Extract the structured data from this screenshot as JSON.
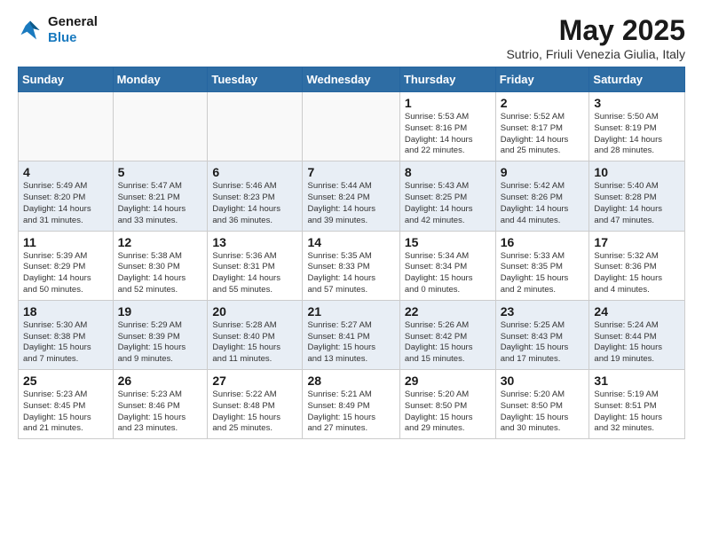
{
  "header": {
    "logo_general": "General",
    "logo_blue": "Blue",
    "month_year": "May 2025",
    "subtitle": "Sutrio, Friuli Venezia Giulia, Italy"
  },
  "days_of_week": [
    "Sunday",
    "Monday",
    "Tuesday",
    "Wednesday",
    "Thursday",
    "Friday",
    "Saturday"
  ],
  "weeks": [
    [
      {
        "day": "",
        "info": ""
      },
      {
        "day": "",
        "info": ""
      },
      {
        "day": "",
        "info": ""
      },
      {
        "day": "",
        "info": ""
      },
      {
        "day": "1",
        "info": "Sunrise: 5:53 AM\nSunset: 8:16 PM\nDaylight: 14 hours\nand 22 minutes."
      },
      {
        "day": "2",
        "info": "Sunrise: 5:52 AM\nSunset: 8:17 PM\nDaylight: 14 hours\nand 25 minutes."
      },
      {
        "day": "3",
        "info": "Sunrise: 5:50 AM\nSunset: 8:19 PM\nDaylight: 14 hours\nand 28 minutes."
      }
    ],
    [
      {
        "day": "4",
        "info": "Sunrise: 5:49 AM\nSunset: 8:20 PM\nDaylight: 14 hours\nand 31 minutes."
      },
      {
        "day": "5",
        "info": "Sunrise: 5:47 AM\nSunset: 8:21 PM\nDaylight: 14 hours\nand 33 minutes."
      },
      {
        "day": "6",
        "info": "Sunrise: 5:46 AM\nSunset: 8:23 PM\nDaylight: 14 hours\nand 36 minutes."
      },
      {
        "day": "7",
        "info": "Sunrise: 5:44 AM\nSunset: 8:24 PM\nDaylight: 14 hours\nand 39 minutes."
      },
      {
        "day": "8",
        "info": "Sunrise: 5:43 AM\nSunset: 8:25 PM\nDaylight: 14 hours\nand 42 minutes."
      },
      {
        "day": "9",
        "info": "Sunrise: 5:42 AM\nSunset: 8:26 PM\nDaylight: 14 hours\nand 44 minutes."
      },
      {
        "day": "10",
        "info": "Sunrise: 5:40 AM\nSunset: 8:28 PM\nDaylight: 14 hours\nand 47 minutes."
      }
    ],
    [
      {
        "day": "11",
        "info": "Sunrise: 5:39 AM\nSunset: 8:29 PM\nDaylight: 14 hours\nand 50 minutes."
      },
      {
        "day": "12",
        "info": "Sunrise: 5:38 AM\nSunset: 8:30 PM\nDaylight: 14 hours\nand 52 minutes."
      },
      {
        "day": "13",
        "info": "Sunrise: 5:36 AM\nSunset: 8:31 PM\nDaylight: 14 hours\nand 55 minutes."
      },
      {
        "day": "14",
        "info": "Sunrise: 5:35 AM\nSunset: 8:33 PM\nDaylight: 14 hours\nand 57 minutes."
      },
      {
        "day": "15",
        "info": "Sunrise: 5:34 AM\nSunset: 8:34 PM\nDaylight: 15 hours\nand 0 minutes."
      },
      {
        "day": "16",
        "info": "Sunrise: 5:33 AM\nSunset: 8:35 PM\nDaylight: 15 hours\nand 2 minutes."
      },
      {
        "day": "17",
        "info": "Sunrise: 5:32 AM\nSunset: 8:36 PM\nDaylight: 15 hours\nand 4 minutes."
      }
    ],
    [
      {
        "day": "18",
        "info": "Sunrise: 5:30 AM\nSunset: 8:38 PM\nDaylight: 15 hours\nand 7 minutes."
      },
      {
        "day": "19",
        "info": "Sunrise: 5:29 AM\nSunset: 8:39 PM\nDaylight: 15 hours\nand 9 minutes."
      },
      {
        "day": "20",
        "info": "Sunrise: 5:28 AM\nSunset: 8:40 PM\nDaylight: 15 hours\nand 11 minutes."
      },
      {
        "day": "21",
        "info": "Sunrise: 5:27 AM\nSunset: 8:41 PM\nDaylight: 15 hours\nand 13 minutes."
      },
      {
        "day": "22",
        "info": "Sunrise: 5:26 AM\nSunset: 8:42 PM\nDaylight: 15 hours\nand 15 minutes."
      },
      {
        "day": "23",
        "info": "Sunrise: 5:25 AM\nSunset: 8:43 PM\nDaylight: 15 hours\nand 17 minutes."
      },
      {
        "day": "24",
        "info": "Sunrise: 5:24 AM\nSunset: 8:44 PM\nDaylight: 15 hours\nand 19 minutes."
      }
    ],
    [
      {
        "day": "25",
        "info": "Sunrise: 5:23 AM\nSunset: 8:45 PM\nDaylight: 15 hours\nand 21 minutes."
      },
      {
        "day": "26",
        "info": "Sunrise: 5:23 AM\nSunset: 8:46 PM\nDaylight: 15 hours\nand 23 minutes."
      },
      {
        "day": "27",
        "info": "Sunrise: 5:22 AM\nSunset: 8:48 PM\nDaylight: 15 hours\nand 25 minutes."
      },
      {
        "day": "28",
        "info": "Sunrise: 5:21 AM\nSunset: 8:49 PM\nDaylight: 15 hours\nand 27 minutes."
      },
      {
        "day": "29",
        "info": "Sunrise: 5:20 AM\nSunset: 8:50 PM\nDaylight: 15 hours\nand 29 minutes."
      },
      {
        "day": "30",
        "info": "Sunrise: 5:20 AM\nSunset: 8:50 PM\nDaylight: 15 hours\nand 30 minutes."
      },
      {
        "day": "31",
        "info": "Sunrise: 5:19 AM\nSunset: 8:51 PM\nDaylight: 15 hours\nand 32 minutes."
      }
    ]
  ]
}
